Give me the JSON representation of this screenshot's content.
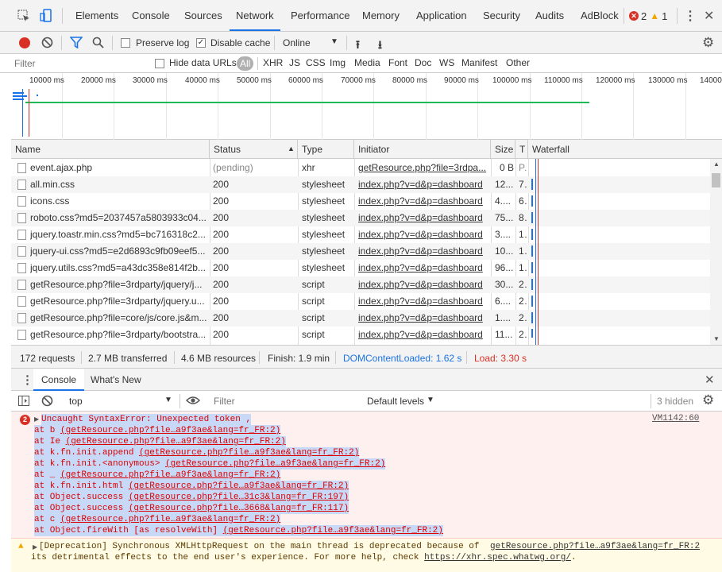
{
  "tabs": [
    "Elements",
    "Console",
    "Sources",
    "Network",
    "Performance",
    "Memory",
    "Application",
    "Security",
    "Audits",
    "AdBlock"
  ],
  "active_tab": "Network",
  "badges": {
    "errors": "2",
    "warnings": "1"
  },
  "toolbar": {
    "preserve_log": "Preserve log",
    "disable_cache": "Disable cache",
    "throttle": "Online"
  },
  "filter": {
    "placeholder": "Filter",
    "hide_data_urls": "Hide data URLs",
    "types": [
      "All",
      "XHR",
      "JS",
      "CSS",
      "Img",
      "Media",
      "Font",
      "Doc",
      "WS",
      "Manifest",
      "Other"
    ]
  },
  "overview_ticks": [
    "10000 ms",
    "20000 ms",
    "30000 ms",
    "40000 ms",
    "50000 ms",
    "60000 ms",
    "70000 ms",
    "80000 ms",
    "90000 ms",
    "100000 ms",
    "110000 ms",
    "120000 ms",
    "130000 ms",
    "14000"
  ],
  "columns": [
    "Name",
    "Status",
    "Type",
    "Initiator",
    "Size",
    "T",
    "Waterfall"
  ],
  "rows": [
    {
      "name": "event.ajax.php",
      "status": "(pending)",
      "type": "xhr",
      "initiator": "getResource.php?file=3rdpa...",
      "size": "0 B",
      "time": "P..."
    },
    {
      "name": "all.min.css",
      "status": "200",
      "type": "stylesheet",
      "initiator": "index.php?v=d&p=dashboard",
      "size": "12...",
      "time": "7..."
    },
    {
      "name": "icons.css",
      "status": "200",
      "type": "stylesheet",
      "initiator": "index.php?v=d&p=dashboard",
      "size": "4....",
      "time": "6..."
    },
    {
      "name": "roboto.css?md5=2037457a5803933c04...",
      "status": "200",
      "type": "stylesheet",
      "initiator": "index.php?v=d&p=dashboard",
      "size": "75...",
      "time": "8..."
    },
    {
      "name": "jquery.toastr.min.css?md5=bc716318c2...",
      "status": "200",
      "type": "stylesheet",
      "initiator": "index.php?v=d&p=dashboard",
      "size": "3....",
      "time": "1..."
    },
    {
      "name": "jquery-ui.css?md5=e2d6893c9fb09eef5...",
      "status": "200",
      "type": "stylesheet",
      "initiator": "index.php?v=d&p=dashboard",
      "size": "10...",
      "time": "1..."
    },
    {
      "name": "jquery.utils.css?md5=a43dc358e814f2b...",
      "status": "200",
      "type": "stylesheet",
      "initiator": "index.php?v=d&p=dashboard",
      "size": "96...",
      "time": "1..."
    },
    {
      "name": "getResource.php?file=3rdparty/jquery/j...",
      "status": "200",
      "type": "script",
      "initiator": "index.php?v=d&p=dashboard",
      "size": "30...",
      "time": "2..."
    },
    {
      "name": "getResource.php?file=3rdparty/jquery.u...",
      "status": "200",
      "type": "script",
      "initiator": "index.php?v=d&p=dashboard",
      "size": "6....",
      "time": "2..."
    },
    {
      "name": "getResource.php?file=core/js/core.js&m...",
      "status": "200",
      "type": "script",
      "initiator": "index.php?v=d&p=dashboard",
      "size": "1....",
      "time": "2..."
    },
    {
      "name": "getResource.php?file=3rdparty/bootstra...",
      "status": "200",
      "type": "script",
      "initiator": "index.php?v=d&p=dashboard",
      "size": "11...",
      "time": "2..."
    }
  ],
  "summary": {
    "requests": "172 requests",
    "transferred": "2.7 MB transferred",
    "resources": "4.6 MB resources",
    "finish": "Finish: 1.9 min",
    "dcl": "DOMContentLoaded: 1.62 s",
    "load": "Load: 3.30 s"
  },
  "console": {
    "tabs": [
      "Console",
      "What's New"
    ],
    "context": "top",
    "filter_placeholder": "Filter",
    "levels": "Default levels",
    "hidden": "3 hidden",
    "error_count": "2",
    "error_title": "Uncaught SyntaxError: Unexpected token ,",
    "error_source": "VM1142:60",
    "trace": [
      {
        "fn": "at b ",
        "loc": "(getResource.php?file…a9f3ae&lang=fr_FR:2)"
      },
      {
        "fn": "at Ie ",
        "loc": "(getResource.php?file…a9f3ae&lang=fr_FR:2)"
      },
      {
        "fn": "at k.fn.init.append ",
        "loc": "(getResource.php?file…a9f3ae&lang=fr_FR:2)"
      },
      {
        "fn": "at k.fn.init.<anonymous> ",
        "loc": "(getResource.php?file…a9f3ae&lang=fr_FR:2)"
      },
      {
        "fn": "at _ ",
        "loc": "(getResource.php?file…a9f3ae&lang=fr_FR:2)"
      },
      {
        "fn": "at k.fn.init.html ",
        "loc": "(getResource.php?file…a9f3ae&lang=fr_FR:2)"
      },
      {
        "fn": "at Object.success ",
        "loc": "(getResource.php?file…31c3&lang=fr_FR:197)"
      },
      {
        "fn": "at Object.success ",
        "loc": "(getResource.php?file…3668&lang=fr_FR:117)"
      },
      {
        "fn": "at c ",
        "loc": "(getResource.php?file…a9f3ae&lang=fr_FR:2)"
      },
      {
        "fn": "at Object.fireWith [as resolveWith] ",
        "loc": "(getResource.php?file…a9f3ae&lang=fr_FR:2)"
      }
    ],
    "warn_line1": "[Deprecation] Synchronous XMLHttpRequest on the main thread is deprecated because of",
    "warn_source": "getResource.php?file…a9f3ae&lang=fr_FR:2",
    "warn_line2": "its detrimental effects to the end user's experience. For more help, check",
    "warn_link": "https://xhr.spec.whatwg.org/",
    "warn_end": "."
  }
}
